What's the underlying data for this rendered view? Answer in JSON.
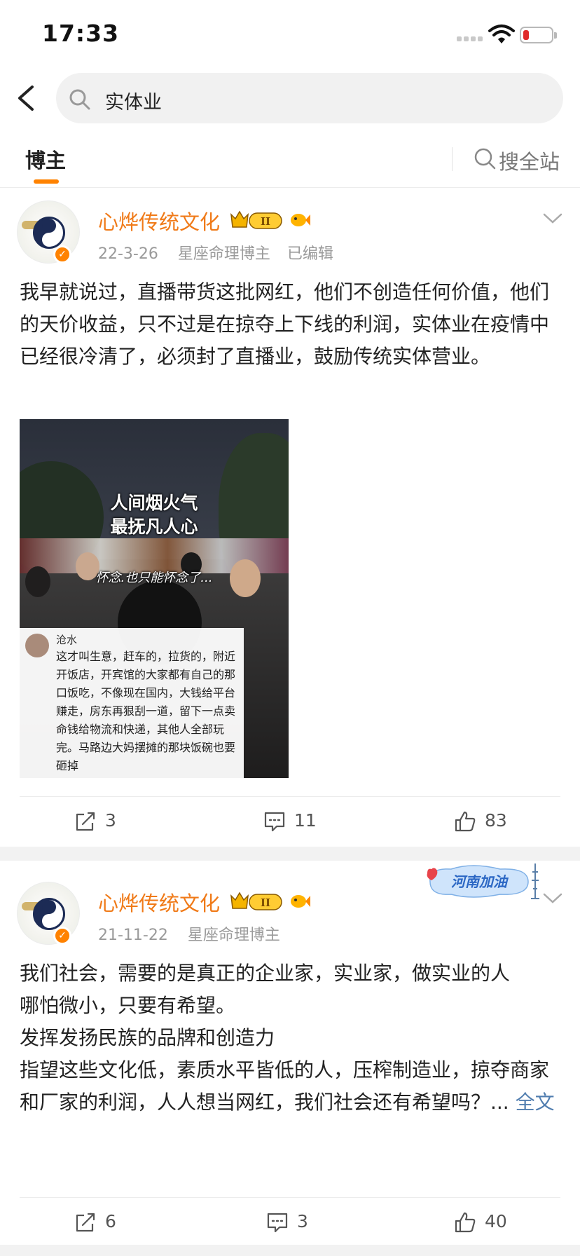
{
  "status_bar": {
    "time": "17:33"
  },
  "search": {
    "query": "实体业"
  },
  "tabs": {
    "active": "博主",
    "search_all": "搜全站"
  },
  "posts": [
    {
      "author": "心烨传统文化",
      "vip_level": "II",
      "date": "22-3-26",
      "category": "星座命理博主",
      "edited": "已编辑",
      "text": [
        "我早就说过，直播带货这批网红，他们不创造任何价值，他们的天价收益，只不过是在掠夺上下线的利润，实体业在疫情中已经很冷清了，必须封了直播业，鼓励传统实体营业。"
      ],
      "image": {
        "caption_line1": "人间烟火气",
        "caption_line2": "最抚凡人心",
        "caption_small": "怀念.也只能怀念了...",
        "comment_name": "沧水",
        "comment_text": "这才叫生意，赶车的，拉货的，附近开饭店，开宾馆的大家都有自己的那口饭吃，不像现在国内，大钱给平台赚走，房东再狠刮一道，留下一点卖命钱给物流和快递，其他人全部玩完。马路边大妈摆摊的那块饭碗也要砸掉"
      },
      "reposts": "3",
      "comments": "11",
      "likes": "83"
    },
    {
      "author": "心烨传统文化",
      "vip_level": "II",
      "date": "21-11-22",
      "category": "星座命理博主",
      "sticker": "河南加油",
      "text": [
        "我们社会，需要的是真正的企业家，实业家，做实业的人",
        "哪怕微小，只要有希望。",
        "发挥发扬民族的品牌和创造力",
        "指望这些文化低，素质水平皆低的人，压榨制造业，掠夺商家和厂家的利润，人人想当网红，我们社会还有希望吗？..."
      ],
      "full_text_link": "全文",
      "reposts": "6",
      "comments": "3",
      "likes": "40"
    }
  ],
  "colors": {
    "accent": "#ff8200",
    "author": "#f07a18",
    "link": "#507daf"
  }
}
